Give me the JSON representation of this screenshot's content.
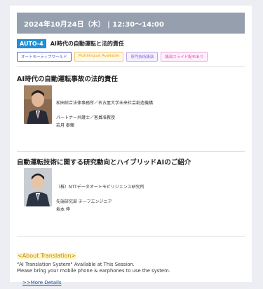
{
  "header": {
    "datetime": "2024年10月24日（木） | 12:30～14:00"
  },
  "session": {
    "code": "AUTO-4",
    "title": "AI時代の自動運転と法的責任",
    "tags": [
      {
        "label": "オートモーティブワールド",
        "color": "#4a5bc4",
        "bg": "#ffffff"
      },
      {
        "label": "Multilingual Available",
        "color": "#e8a317",
        "bg": "#fff8e6"
      },
      {
        "label": "専門技術講演",
        "color": "#8a6cc9",
        "bg": "#f5f0ff"
      },
      {
        "label": "講演スライド配布あり",
        "color": "#d35ab5",
        "bg": "#fff0fa"
      }
    ]
  },
  "talks": [
    {
      "title": "AI時代の自動運転事故の法的責任",
      "aff1": "松田綜合法律事務所／名古屋大学未来社会創造機構",
      "aff2": "パートナー弁護士／客員准教授",
      "name": "岩月 泰頼"
    },
    {
      "title": "自動運転技術に関する研究動向とハイブリッドAIのご紹介",
      "aff1": "（株）NTTデータオートモビリジェンス研究所",
      "aff2": "先端研究部 チーフエンジニア",
      "name": "坂本 伸"
    }
  ],
  "about": {
    "title": "<About Translation>",
    "line1": "\"AI Translation System\" Available at This Session.",
    "line2": "Please bring your mobile phone & earphones to use the system.",
    "link": ">>More Details"
  }
}
